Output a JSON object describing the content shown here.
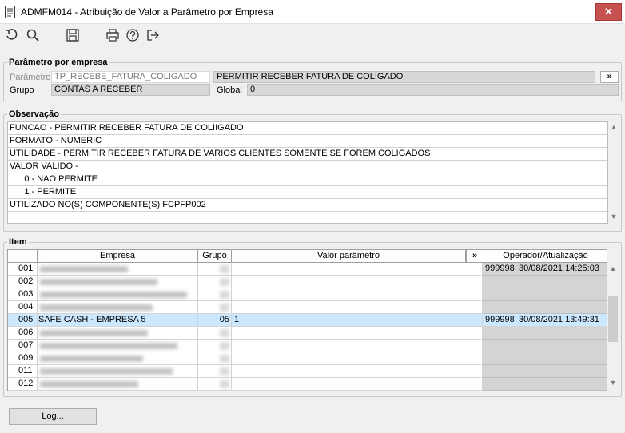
{
  "window": {
    "title": "ADMFM014 - Atribuição de Valor a Parâmetro por Empresa",
    "close_glyph": "✕"
  },
  "toolbar": {
    "icons": [
      "undo-icon",
      "search-icon",
      "save-icon",
      "print-icon",
      "help-icon",
      "exit-icon"
    ]
  },
  "param_section": {
    "legend": "Parâmetro por empresa",
    "parametro_label": "Parâmetro",
    "parametro_value": "TP_RECEBE_FATURA_COLIGADO",
    "parametro_desc": "PERMITIR RECEBER FATURA DE COLIGADO",
    "expand_label": "»",
    "grupo_label": "Grupo",
    "grupo_value": "CONTAS A RECEBER",
    "global_label": "Global",
    "global_value": "0"
  },
  "obs_section": {
    "legend": "Observação",
    "lines": [
      "FUNCAO - PERMITIR RECEBER FATURA DE COLIIGADO",
      "FORMATO - NUMERIC",
      "UTILIDADE - PERMITIR RECEBER FATURA DE VARIOS CLIENTES SOMENTE SE FOREM COLIGADOS",
      "VALOR VALIDO -",
      "      0 - NAO PERMITE",
      "      1 - PERMITE",
      "UTILIZADO NO(S) COMPONENTE(S) FCPFP002"
    ]
  },
  "item_section": {
    "legend": "Item",
    "columns": {
      "empresa": "Empresa",
      "grupo": "Grupo",
      "valor": "Valor parâmetro",
      "expand": "»",
      "operador": "Operador/Atualização"
    },
    "rows": [
      {
        "code": "001",
        "empresa": "",
        "grupo": "",
        "valor": "",
        "operador": "999998",
        "data": "30/08/2021 14:25:03"
      },
      {
        "code": "002",
        "empresa": "",
        "grupo": "",
        "valor": "",
        "operador": "",
        "data": ""
      },
      {
        "code": "003",
        "empresa": "",
        "grupo": "",
        "valor": "",
        "operador": "",
        "data": ""
      },
      {
        "code": "004",
        "empresa": "",
        "grupo": "",
        "valor": "",
        "operador": "",
        "data": ""
      },
      {
        "code": "005",
        "empresa": "SAFE CASH -  EMPRESA 5",
        "grupo": "05",
        "valor": "1",
        "operador": "999998",
        "data": "30/08/2021 13:49:31"
      },
      {
        "code": "006",
        "empresa": "",
        "grupo": "",
        "valor": "",
        "operador": "",
        "data": ""
      },
      {
        "code": "007",
        "empresa": "",
        "grupo": "",
        "valor": "",
        "operador": "",
        "data": ""
      },
      {
        "code": "009",
        "empresa": "",
        "grupo": "",
        "valor": "",
        "operador": "",
        "data": ""
      },
      {
        "code": "011",
        "empresa": "",
        "grupo": "",
        "valor": "",
        "operador": "",
        "data": ""
      },
      {
        "code": "012",
        "empresa": "",
        "grupo": "",
        "valor": "",
        "operador": "",
        "data": ""
      }
    ],
    "selected_row_color": "#cce8ff"
  },
  "footer": {
    "log_button": "Log..."
  }
}
